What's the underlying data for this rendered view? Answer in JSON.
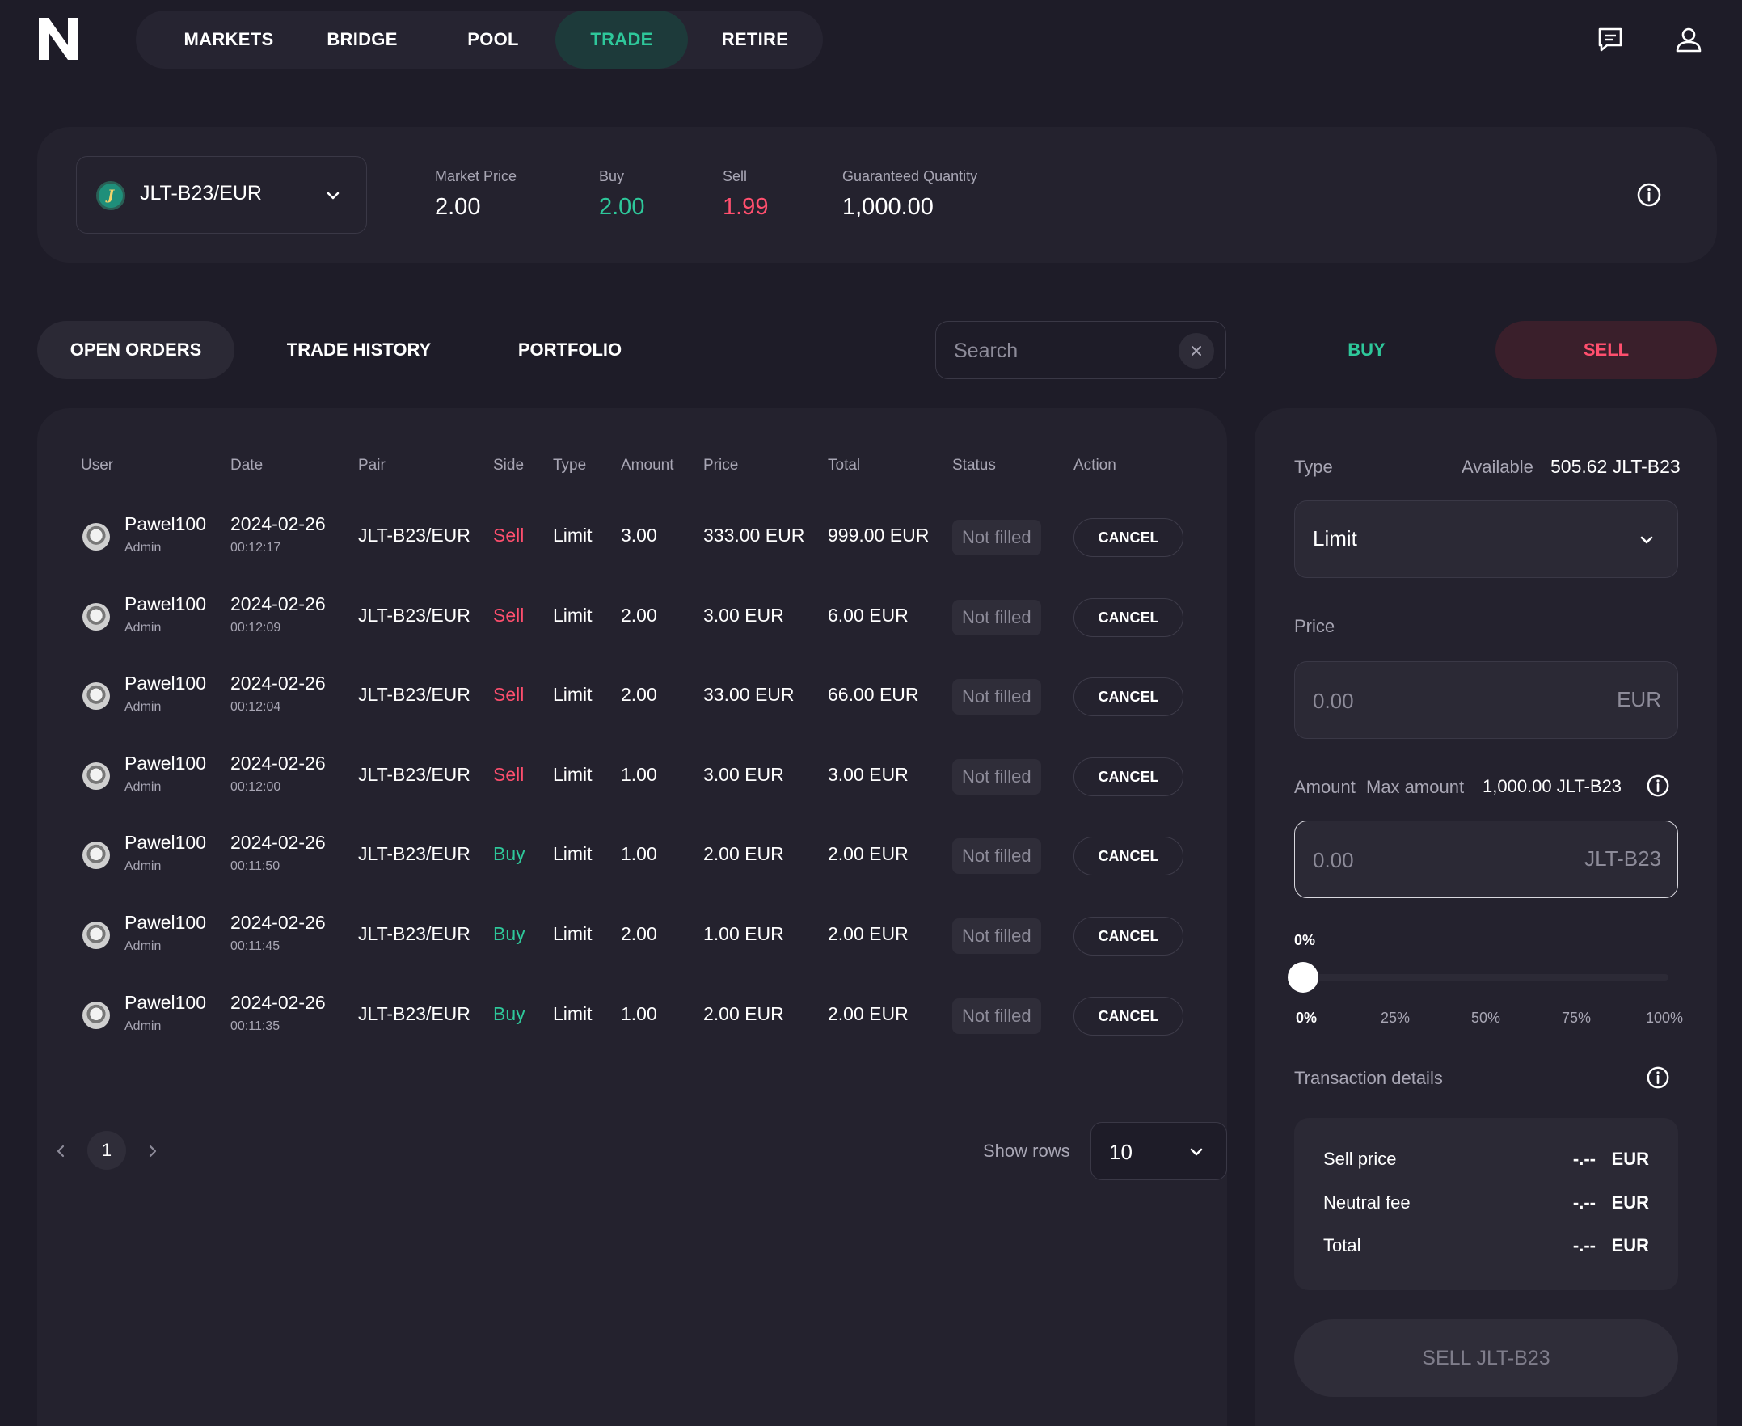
{
  "nav": {
    "items": [
      {
        "label": "MARKETS"
      },
      {
        "label": "BRIDGE"
      },
      {
        "label": "POOL"
      },
      {
        "label": "TRADE"
      },
      {
        "label": "RETIRE"
      }
    ],
    "active": "TRADE"
  },
  "market": {
    "pair": "JLT-B23/EUR",
    "pair_icon_letter": "J",
    "market_price_label": "Market Price",
    "market_price": "2.00",
    "buy_label": "Buy",
    "buy_price": "2.00",
    "sell_label": "Sell",
    "sell_price": "1.99",
    "guaranteed_label": "Guaranteed Quantity",
    "guaranteed_qty": "1,000.00"
  },
  "tabs": {
    "open_orders": "OPEN ORDERS",
    "trade_history": "TRADE HISTORY",
    "portfolio": "PORTFOLIO"
  },
  "search": {
    "placeholder": "Search"
  },
  "side_tabs": {
    "buy": "BUY",
    "sell": "SELL"
  },
  "table": {
    "headers": {
      "user": "User",
      "date": "Date",
      "pair": "Pair",
      "side": "Side",
      "type": "Type",
      "amount": "Amount",
      "price": "Price",
      "total": "Total",
      "status": "Status",
      "action": "Action"
    },
    "rows": [
      {
        "user": "Pawel100",
        "role": "Admin",
        "date": "2024-02-26",
        "time": "00:12:17",
        "pair": "JLT-B23/EUR",
        "side": "Sell",
        "type": "Limit",
        "amount": "3.00",
        "price": "333.00 EUR",
        "total": "999.00 EUR",
        "status": "Not filled",
        "action": "CANCEL"
      },
      {
        "user": "Pawel100",
        "role": "Admin",
        "date": "2024-02-26",
        "time": "00:12:09",
        "pair": "JLT-B23/EUR",
        "side": "Sell",
        "type": "Limit",
        "amount": "2.00",
        "price": "3.00 EUR",
        "total": "6.00 EUR",
        "status": "Not filled",
        "action": "CANCEL"
      },
      {
        "user": "Pawel100",
        "role": "Admin",
        "date": "2024-02-26",
        "time": "00:12:04",
        "pair": "JLT-B23/EUR",
        "side": "Sell",
        "type": "Limit",
        "amount": "2.00",
        "price": "33.00 EUR",
        "total": "66.00 EUR",
        "status": "Not filled",
        "action": "CANCEL"
      },
      {
        "user": "Pawel100",
        "role": "Admin",
        "date": "2024-02-26",
        "time": "00:12:00",
        "pair": "JLT-B23/EUR",
        "side": "Sell",
        "type": "Limit",
        "amount": "1.00",
        "price": "3.00 EUR",
        "total": "3.00 EUR",
        "status": "Not filled",
        "action": "CANCEL"
      },
      {
        "user": "Pawel100",
        "role": "Admin",
        "date": "2024-02-26",
        "time": "00:11:50",
        "pair": "JLT-B23/EUR",
        "side": "Buy",
        "type": "Limit",
        "amount": "1.00",
        "price": "2.00 EUR",
        "total": "2.00 EUR",
        "status": "Not filled",
        "action": "CANCEL"
      },
      {
        "user": "Pawel100",
        "role": "Admin",
        "date": "2024-02-26",
        "time": "00:11:45",
        "pair": "JLT-B23/EUR",
        "side": "Buy",
        "type": "Limit",
        "amount": "2.00",
        "price": "1.00 EUR",
        "total": "2.00 EUR",
        "status": "Not filled",
        "action": "CANCEL"
      },
      {
        "user": "Pawel100",
        "role": "Admin",
        "date": "2024-02-26",
        "time": "00:11:35",
        "pair": "JLT-B23/EUR",
        "side": "Buy",
        "type": "Limit",
        "amount": "1.00",
        "price": "2.00 EUR",
        "total": "2.00 EUR",
        "status": "Not filled",
        "action": "CANCEL"
      }
    ]
  },
  "pagination": {
    "current_page": "1",
    "show_rows_label": "Show rows",
    "rows_value": "10"
  },
  "panel": {
    "type_label": "Type",
    "available_label": "Available",
    "available_value": "505.62 JLT-B23",
    "type_value": "Limit",
    "price_label": "Price",
    "price_placeholder": "0.00",
    "price_unit": "EUR",
    "amount_label": "Amount",
    "max_amount_label": "Max amount",
    "max_amount_value": "1,000.00 JLT-B23",
    "amount_placeholder": "0.00",
    "amount_unit": "JLT-B23",
    "slider_value_label": "0%",
    "slider_percent": 0,
    "ticks": [
      "0%",
      "25%",
      "50%",
      "75%",
      "100%"
    ],
    "details_title": "Transaction details",
    "details": [
      {
        "label": "Sell price",
        "value": "-.--",
        "currency": "EUR"
      },
      {
        "label": "Neutral fee",
        "value": "-.--",
        "currency": "EUR"
      },
      {
        "label": "Total",
        "value": "-.--",
        "currency": "EUR"
      }
    ],
    "submit_label": "SELL JLT-B23"
  },
  "colors": {
    "buy": "#2ec79a",
    "sell": "#ff4f6e",
    "background": "#1e1c28",
    "card": "#24222e"
  }
}
